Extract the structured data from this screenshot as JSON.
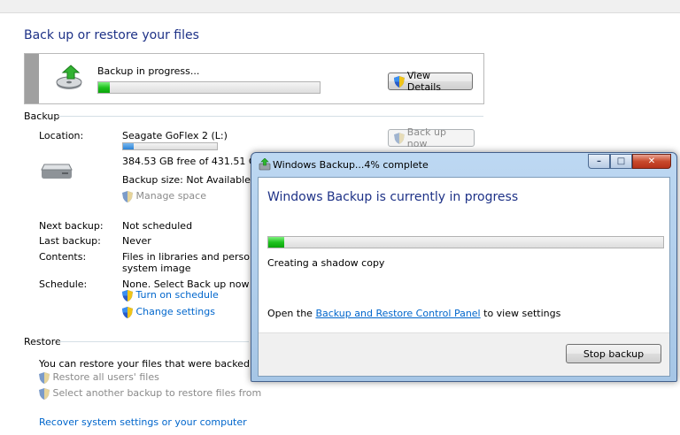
{
  "page": {
    "title": "Back up or restore your files"
  },
  "progress": {
    "status": "Backup in progress...",
    "percent": 2,
    "view_details_label": "View Details"
  },
  "backup": {
    "section_label": "Backup",
    "location_label": "Location:",
    "drive_name": "Seagate GoFlex 2 (L:)",
    "drive_used_fraction": 0.11,
    "free_space": "384.53 GB free of 431.51 GB",
    "backup_size": "Backup size: Not Available",
    "manage_space": "Manage space",
    "back_up_now": "Back up now",
    "next_backup_label": "Next backup:",
    "next_backup_value": "Not scheduled",
    "last_backup_label": "Last backup:",
    "last_backup_value": "Never",
    "contents_label": "Contents:",
    "contents_line1": "Files in libraries and personal fo",
    "contents_line2": "system image",
    "schedule_label": "Schedule:",
    "schedule_value": "None. Select Back up now to ru",
    "turn_on_schedule": "Turn on schedule",
    "change_settings": "Change settings"
  },
  "restore": {
    "section_label": "Restore",
    "description": "You can restore your files that were backed up on th",
    "restore_all_users": "Restore all users' files",
    "select_another": "Select another backup to restore files from",
    "recover_system": "Recover system settings or your computer"
  },
  "dialog": {
    "title": "Windows Backup...4% complete",
    "heading": "Windows Backup is currently in progress",
    "percent": 4,
    "status": "Creating a shadow copy",
    "text_before_link": "Open the",
    "link_text": "Backup and Restore Control Panel",
    "text_after_link": "to view settings",
    "stop_label": "Stop backup"
  },
  "colors": {
    "heading_blue": "#1e3287",
    "link_blue": "#0066cc",
    "progress_green": "#1fc31f"
  }
}
